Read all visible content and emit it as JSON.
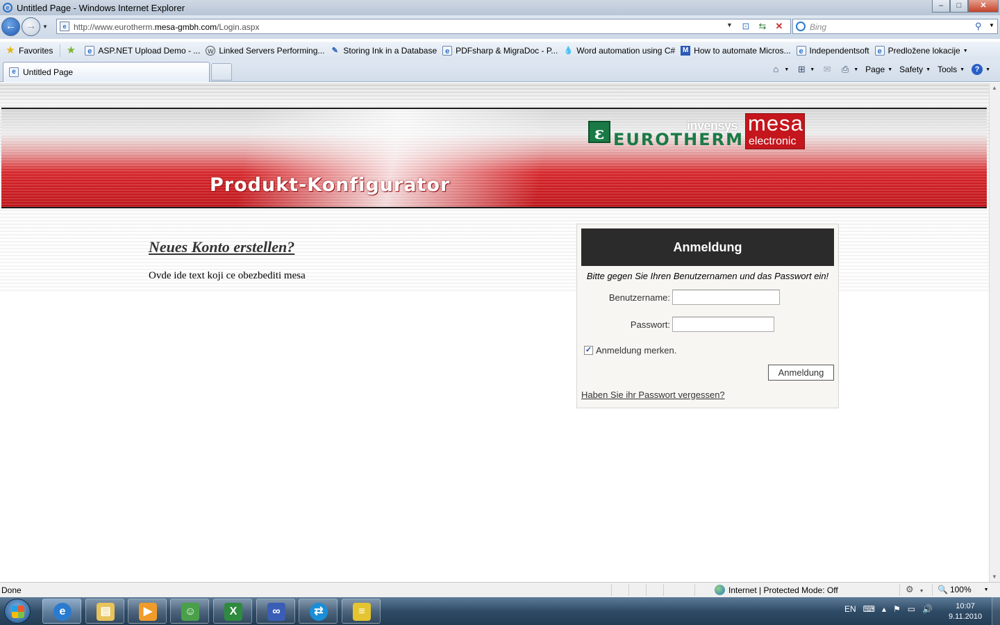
{
  "window": {
    "title": "Untitled Page - Windows Internet Explorer",
    "buttons": {
      "minimize": "–",
      "maximize": "□",
      "close": "✕"
    }
  },
  "address": {
    "url_prefix": "http://www.eurotherm.",
    "url_domain": "mesa-gmbh.com",
    "url_suffix": "/Login.aspx",
    "search_placeholder": "Bing"
  },
  "favorites": {
    "label": "Favorites",
    "items": [
      {
        "label": "ASP.NET Upload Demo - ...",
        "icon": "ie-page-icon"
      },
      {
        "label": "Linked Servers Performing...",
        "icon": "wordpress-icon"
      },
      {
        "label": "Storing Ink in a Database",
        "icon": "ink-icon"
      },
      {
        "label": "PDFsharp & MigraDoc - P...",
        "icon": "ie-page-icon"
      },
      {
        "label": "Word automation using C#",
        "icon": "drop-icon"
      },
      {
        "label": "How to automate Micros...",
        "icon": "ms-icon"
      },
      {
        "label": "Independentsoft",
        "icon": "ie-page-icon"
      },
      {
        "label": "Predložene lokacije",
        "icon": "ie-page-icon"
      }
    ]
  },
  "tabs": {
    "active_label": "Untitled Page"
  },
  "commandbar": {
    "page": "Page",
    "safety": "Safety",
    "tools": "Tools",
    "help": "?"
  },
  "page": {
    "banner_title": "Produkt-Konfigurator",
    "logo": {
      "e": "ε",
      "invensys": "invensys",
      "eurotherm": "EUROTHERM",
      "mesa": "mesa",
      "electronic": "electronic"
    },
    "signup_title": "Neues Konto erstellen?",
    "signup_text": "Ovde ide text koji ce obezbediti mesa",
    "login": {
      "header": "Anmeldung",
      "instructions": "Bitte gegen Sie Ihren Benutzernamen und das Passwort ein!",
      "username_label": "Benutzername:",
      "username_value": "",
      "password_label": "Passwort:",
      "password_value": "",
      "remember_label": "Anmeldung merken.",
      "remember_checked": true,
      "submit_label": "Anmeldung",
      "forgot_link": "Haben Sie ihr Passwort vergessen?"
    }
  },
  "statusbar": {
    "status": "Done",
    "zone": "Internet | Protected Mode: Off",
    "zoom": "100%"
  },
  "taskbar": {
    "language": "EN",
    "time": "10:07",
    "date": "9.11.2010"
  },
  "colors": {
    "banner_red": "#c4161c",
    "eurotherm_green": "#1a7a46",
    "login_header": "#2b2b2b"
  }
}
